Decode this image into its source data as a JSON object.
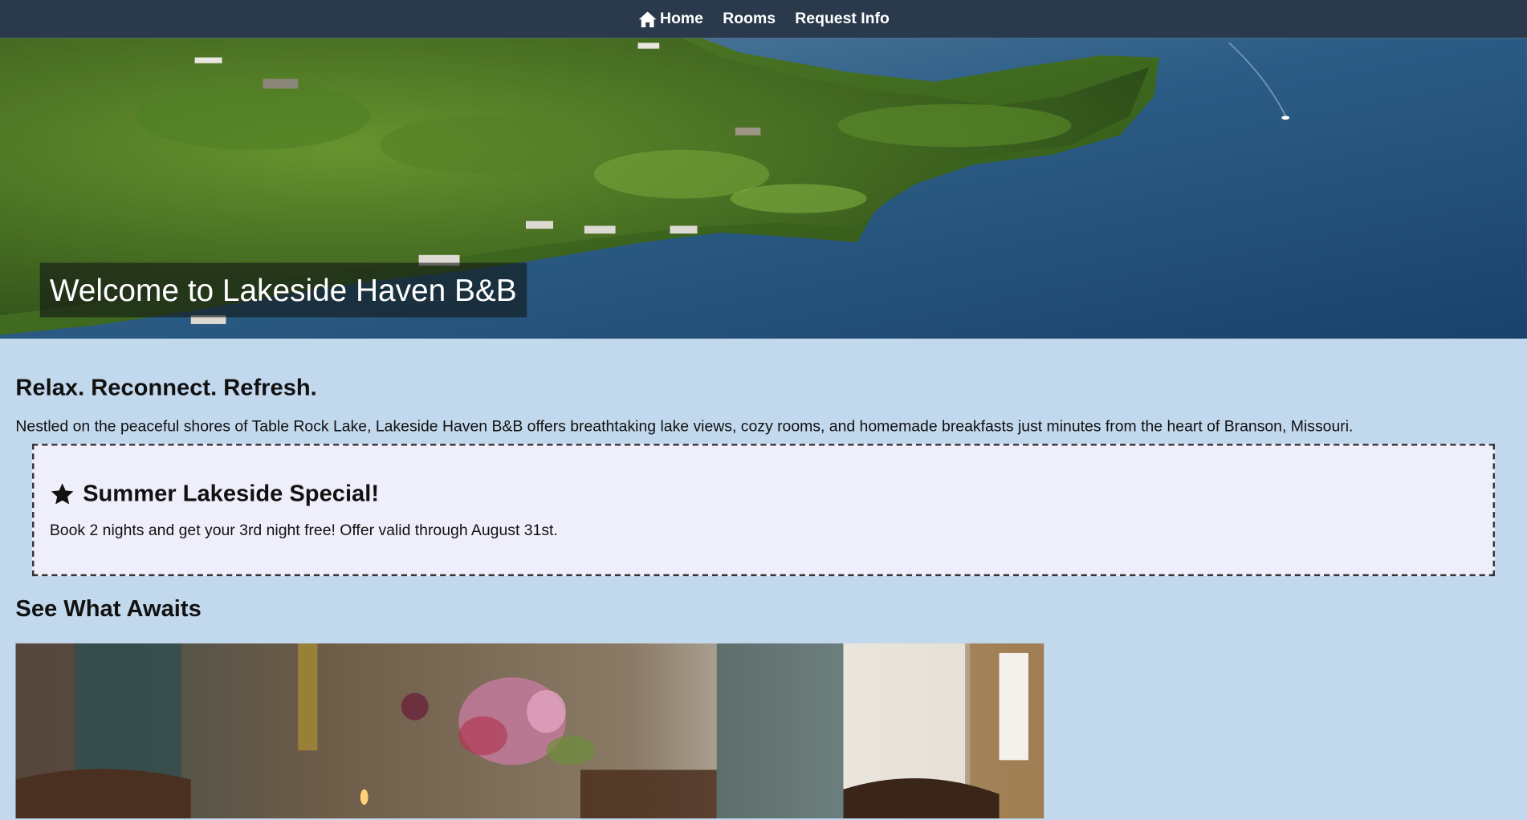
{
  "nav": {
    "home_label": "Home",
    "rooms_label": "Rooms",
    "request_label": "Request Info"
  },
  "hero": {
    "title": "Welcome to Lakeside Haven B&B"
  },
  "intro": {
    "heading": "Relax. Reconnect. Refresh.",
    "text": "Nestled on the peaceful shores of Table Rock Lake, Lakeside Haven B&B offers breathtaking lake views, cozy rooms, and homemade breakfasts just minutes from the heart of Branson, Missouri."
  },
  "special": {
    "icon": "star-icon",
    "heading": "Summer Lakeside Special!",
    "text": "Book 2 nights and get your 3rd night free! Offer valid through August 31st."
  },
  "gallery": {
    "heading": "See What Awaits"
  },
  "colors": {
    "nav_bg": "#2a3a4c",
    "page_bg": "#c2d8ec",
    "special_bg": "#efeffc"
  }
}
